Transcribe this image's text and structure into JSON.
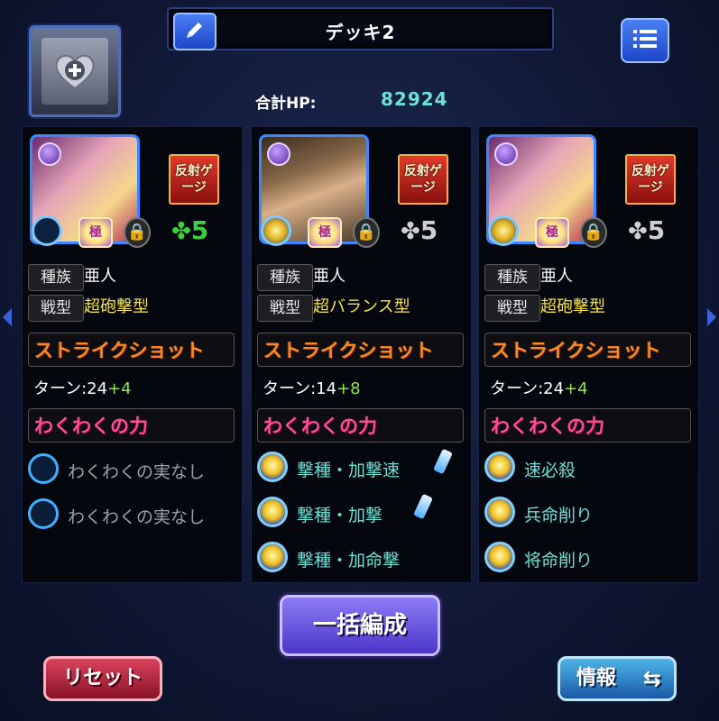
{
  "header": {
    "deck_title": "デッキ2",
    "hp_label": "合計HP:",
    "hp_value": "82924"
  },
  "icons": {
    "edit": "pencil-icon",
    "list": "list-icon",
    "favorite": "heart-plus-icon"
  },
  "cards": [
    {
      "gauge": "反射ゲージ",
      "luck": "5",
      "luck_color": "#3bd13b",
      "tribe_label": "種族",
      "tribe": "亜人",
      "type_label": "戦型",
      "type": "超砲撃型",
      "ss_title": "ストライクショット",
      "turn_label": "ターン:24",
      "turn_plus": "+4",
      "wk_title": "わくわくの力",
      "fruits": [
        {
          "label": "わくわくの実なし",
          "filled": false,
          "bottle": false
        },
        {
          "label": "わくわくの実なし",
          "filled": false,
          "bottle": false
        }
      ]
    },
    {
      "gauge": "反射ゲージ",
      "luck": "5",
      "luck_color": "#cfcfcf",
      "tribe_label": "種族",
      "tribe": "亜人",
      "type_label": "戦型",
      "type": "超バランス型",
      "ss_title": "ストライクショット",
      "turn_label": "ターン:14",
      "turn_plus": "+8",
      "wk_title": "わくわくの力",
      "fruits": [
        {
          "label": "撃種・加撃速",
          "filled": true,
          "bottle": true
        },
        {
          "label": "撃種・加撃",
          "filled": true,
          "bottle": true
        },
        {
          "label": "撃種・加命撃",
          "filled": true,
          "bottle": false
        }
      ]
    },
    {
      "gauge": "反射ゲージ",
      "luck": "5",
      "luck_color": "#cfcfcf",
      "tribe_label": "種族",
      "tribe": "亜人",
      "type_label": "戦型",
      "type": "超砲撃型",
      "ss_title": "ストライクショット",
      "turn_label": "ターン:24",
      "turn_plus": "+4",
      "wk_title": "わくわくの力",
      "fruits": [
        {
          "label": "速必殺",
          "filled": true,
          "bottle": false
        },
        {
          "label": "兵命削り",
          "filled": true,
          "bottle": false
        },
        {
          "label": "将命削り",
          "filled": true,
          "bottle": false
        }
      ]
    }
  ],
  "buttons": {
    "bulk": "一括編成",
    "reset": "リセット",
    "info": "情報",
    "info_icon": "⇆"
  }
}
